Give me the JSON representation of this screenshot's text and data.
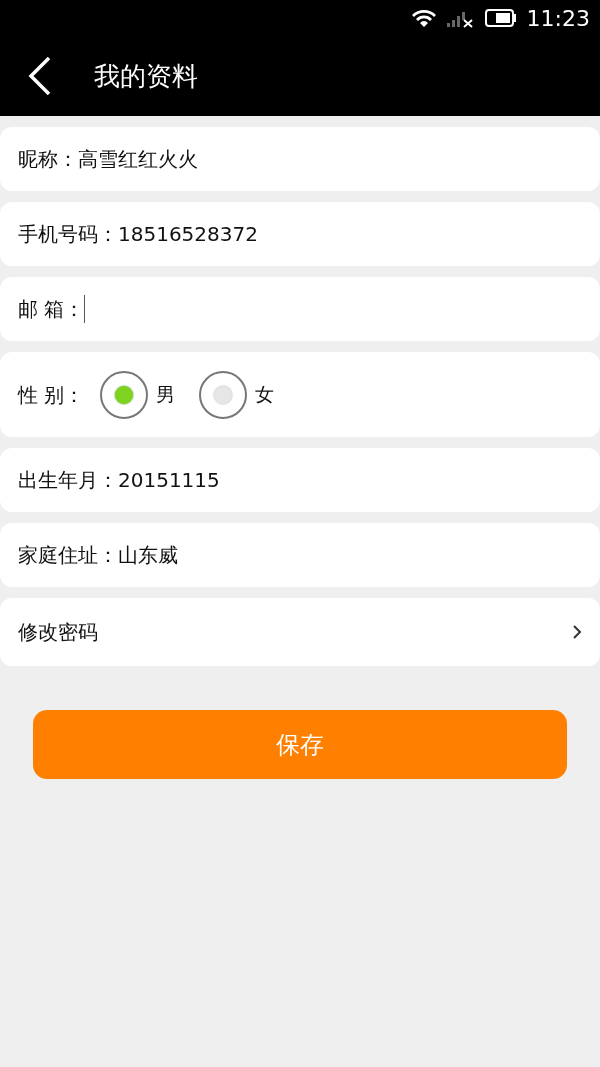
{
  "status_bar": {
    "time": "11:23"
  },
  "header": {
    "title": "我的资料"
  },
  "fields": [
    {
      "kind": "text",
      "label": "昵称：",
      "value": "高雪红红火火"
    },
    {
      "kind": "text",
      "label": "手机号码：",
      "value": "18516528372"
    },
    {
      "kind": "text",
      "label": "邮 箱：",
      "focused": true
    },
    {
      "kind": "radio",
      "label": "性 别：",
      "options": [
        {
          "label": "男",
          "selected": true
        },
        {
          "label": "女",
          "selected": false
        }
      ]
    },
    {
      "kind": "text",
      "label": "出生年月：",
      "value": "20151115"
    },
    {
      "kind": "text",
      "label": "家庭住址：",
      "value": "山东威"
    },
    {
      "kind": "link",
      "label": "修改密码"
    }
  ],
  "save_button": "保存"
}
